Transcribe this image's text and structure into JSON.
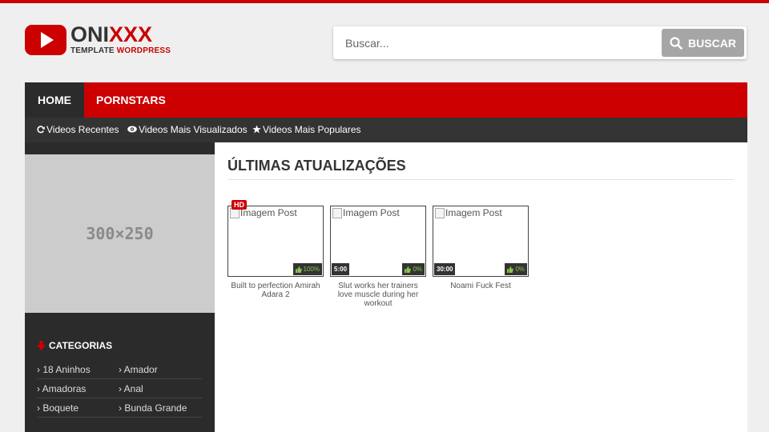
{
  "header": {
    "logo_part1": "ONI",
    "logo_part2": "XXX",
    "logo_sub1": "TEMPLATE ",
    "logo_sub2": "WORDPRESS",
    "search_placeholder": "Buscar...",
    "search_button": "BUSCAR"
  },
  "nav": {
    "items": [
      {
        "label": "HOME"
      },
      {
        "label": "PORNSTARS"
      }
    ]
  },
  "subnav": {
    "items": [
      {
        "label": "Videos Recentes",
        "icon": "refresh-icon"
      },
      {
        "label": "Videos Mais Visualizados",
        "icon": "eye-icon"
      },
      {
        "label": "Videos Mais Populares",
        "icon": "star-icon"
      }
    ]
  },
  "sidebar": {
    "ad_label": "300×250",
    "categories_title": "CATEGORIAS",
    "categories": [
      [
        "18 Aninhos",
        "Amador"
      ],
      [
        "Amadoras",
        "Anal"
      ],
      [
        "Boquete",
        "Bunda Grande"
      ]
    ]
  },
  "main": {
    "section_title": "ÚLTIMAS ATUALIZAÇÕES",
    "videos": [
      {
        "alt": "Imagem Post",
        "badge": "HD",
        "duration": "",
        "rating": "100%",
        "title": "Built to perfection Amirah Adara 2"
      },
      {
        "alt": "Imagem Post",
        "badge": "",
        "duration": "5:00",
        "rating": "0%",
        "title": "Slut works her trainers love muscle during her workout"
      },
      {
        "alt": "Imagem Post",
        "badge": "",
        "duration": "30:00",
        "rating": "0%",
        "title": "Noami Fuck Fest"
      }
    ]
  },
  "colors": {
    "accent": "#cc0000",
    "dark": "#2b2b2b",
    "subnav": "#333333",
    "rating": "#8bc34a"
  }
}
